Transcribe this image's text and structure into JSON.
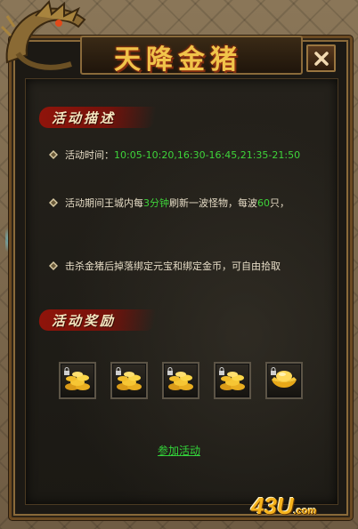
{
  "window": {
    "title": "天降金猪",
    "close_label": "✕"
  },
  "sections": {
    "description": {
      "heading": "活动描述",
      "lines": {
        "time_prefix": "活动时间：",
        "time_value": "10:05-10:20,16:30-16:45,21:35-21:50",
        "spawn_part1": "活动期间王城内每",
        "spawn_interval": "3分钟",
        "spawn_part2": "刷新一波怪物，每波",
        "spawn_count": "60",
        "spawn_part3": "只，",
        "drop_text": "击杀金猪后掉落绑定元宝和绑定金币，可自由拾取"
      }
    },
    "rewards": {
      "heading": "活动奖励",
      "items": [
        {
          "icon": "gold-coins-icon",
          "locked": true
        },
        {
          "icon": "gold-coins-icon",
          "locked": true
        },
        {
          "icon": "gold-coins-icon",
          "locked": true
        },
        {
          "icon": "gold-coins-icon",
          "locked": true
        },
        {
          "icon": "gold-ingot-icon",
          "locked": true
        }
      ]
    }
  },
  "actions": {
    "join_label": "参加活动"
  },
  "watermark": {
    "logo_text": "43U",
    "logo_suffix": ".com"
  },
  "colors": {
    "highlight_green": "#3ed43a",
    "title_gold": "#f1c44a",
    "banner_red": "#96140a"
  }
}
